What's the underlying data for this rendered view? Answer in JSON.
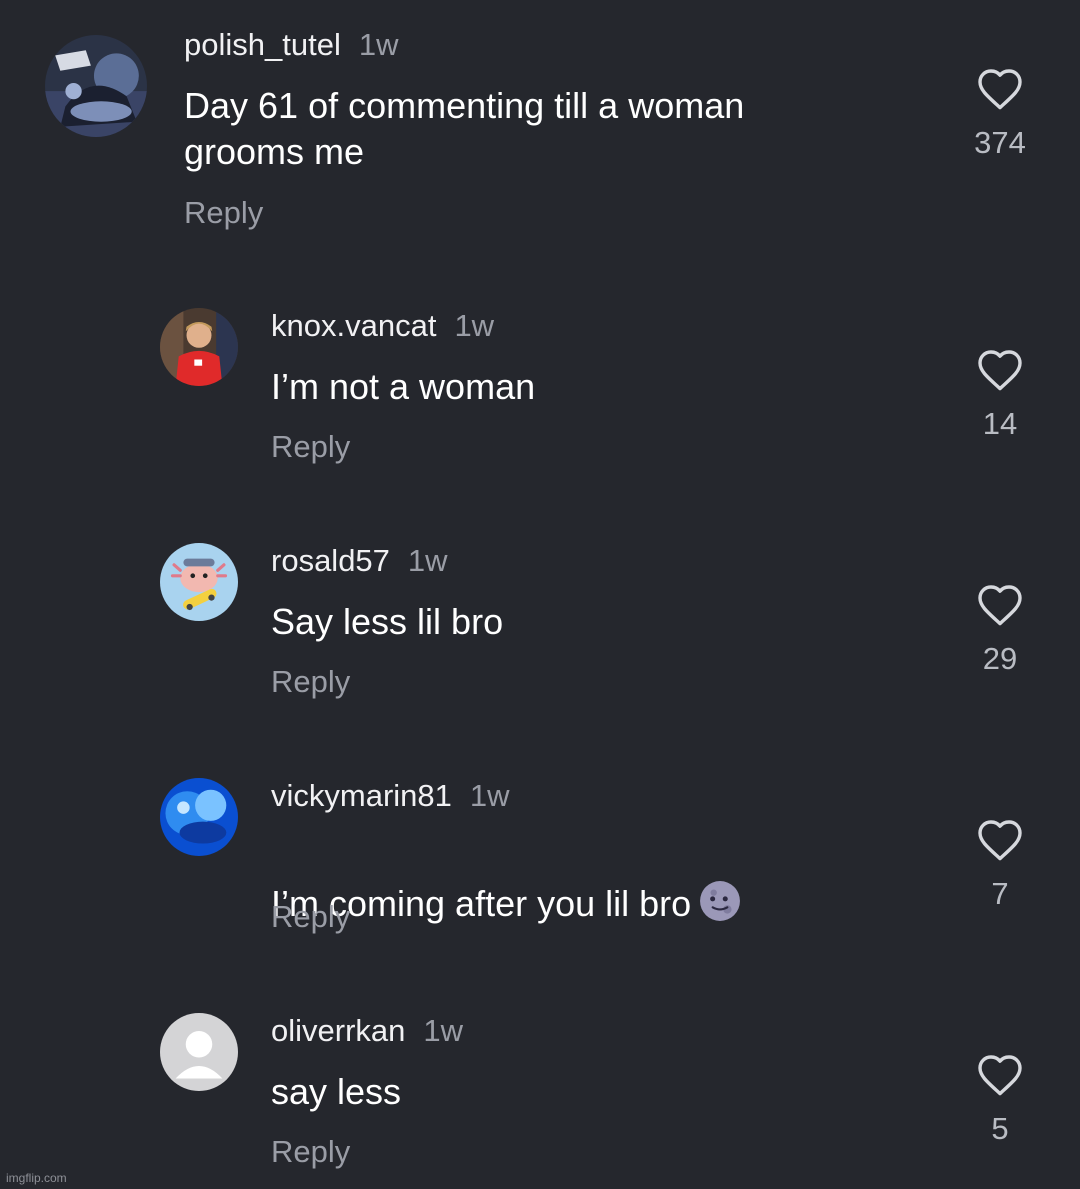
{
  "comments": [
    {
      "username": "polish_tutel",
      "time": "1w",
      "text": "Day 61 of commenting till a woman\ngrooms me",
      "reply_label": "Reply",
      "likes": "374",
      "avatar": "motorcycle-rider-avatar"
    },
    {
      "username": "knox.vancat",
      "time": "1w",
      "text": "I’m not a woman",
      "reply_label": "Reply",
      "likes": "14",
      "avatar": "person-red-shirt-avatar"
    },
    {
      "username": "rosald57",
      "time": "1w",
      "text": "Say less lil bro",
      "reply_label": "Reply",
      "likes": "29",
      "avatar": "axolotl-skateboard-avatar"
    },
    {
      "username": "vickymarin81",
      "time": "1w",
      "text": "I’m coming after you lil bro",
      "emoji": "new-moon-face-emoji",
      "reply_label": "Reply",
      "likes": "7",
      "avatar": "blue-abstract-avatar"
    },
    {
      "username": "oliverrkan",
      "time": "1w",
      "text": "say less",
      "reply_label": "Reply",
      "likes": "5",
      "avatar": "default-avatar"
    }
  ],
  "watermark": "imgflip.com",
  "colors": {
    "background": "#25272d",
    "secondary_text": "#9a9da6",
    "primary_text": "#ffffff"
  }
}
